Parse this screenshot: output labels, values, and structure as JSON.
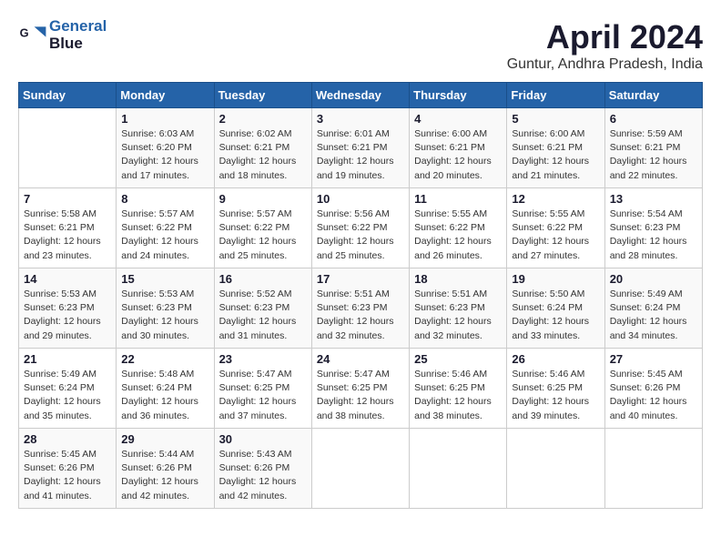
{
  "header": {
    "logo_line1": "General",
    "logo_line2": "Blue",
    "month_title": "April 2024",
    "location": "Guntur, Andhra Pradesh, India"
  },
  "columns": [
    "Sunday",
    "Monday",
    "Tuesday",
    "Wednesday",
    "Thursday",
    "Friday",
    "Saturday"
  ],
  "weeks": [
    [
      {
        "day": "",
        "info": ""
      },
      {
        "day": "1",
        "info": "Sunrise: 6:03 AM\nSunset: 6:20 PM\nDaylight: 12 hours\nand 17 minutes."
      },
      {
        "day": "2",
        "info": "Sunrise: 6:02 AM\nSunset: 6:21 PM\nDaylight: 12 hours\nand 18 minutes."
      },
      {
        "day": "3",
        "info": "Sunrise: 6:01 AM\nSunset: 6:21 PM\nDaylight: 12 hours\nand 19 minutes."
      },
      {
        "day": "4",
        "info": "Sunrise: 6:00 AM\nSunset: 6:21 PM\nDaylight: 12 hours\nand 20 minutes."
      },
      {
        "day": "5",
        "info": "Sunrise: 6:00 AM\nSunset: 6:21 PM\nDaylight: 12 hours\nand 21 minutes."
      },
      {
        "day": "6",
        "info": "Sunrise: 5:59 AM\nSunset: 6:21 PM\nDaylight: 12 hours\nand 22 minutes."
      }
    ],
    [
      {
        "day": "7",
        "info": "Sunrise: 5:58 AM\nSunset: 6:21 PM\nDaylight: 12 hours\nand 23 minutes."
      },
      {
        "day": "8",
        "info": "Sunrise: 5:57 AM\nSunset: 6:22 PM\nDaylight: 12 hours\nand 24 minutes."
      },
      {
        "day": "9",
        "info": "Sunrise: 5:57 AM\nSunset: 6:22 PM\nDaylight: 12 hours\nand 25 minutes."
      },
      {
        "day": "10",
        "info": "Sunrise: 5:56 AM\nSunset: 6:22 PM\nDaylight: 12 hours\nand 25 minutes."
      },
      {
        "day": "11",
        "info": "Sunrise: 5:55 AM\nSunset: 6:22 PM\nDaylight: 12 hours\nand 26 minutes."
      },
      {
        "day": "12",
        "info": "Sunrise: 5:55 AM\nSunset: 6:22 PM\nDaylight: 12 hours\nand 27 minutes."
      },
      {
        "day": "13",
        "info": "Sunrise: 5:54 AM\nSunset: 6:23 PM\nDaylight: 12 hours\nand 28 minutes."
      }
    ],
    [
      {
        "day": "14",
        "info": "Sunrise: 5:53 AM\nSunset: 6:23 PM\nDaylight: 12 hours\nand 29 minutes."
      },
      {
        "day": "15",
        "info": "Sunrise: 5:53 AM\nSunset: 6:23 PM\nDaylight: 12 hours\nand 30 minutes."
      },
      {
        "day": "16",
        "info": "Sunrise: 5:52 AM\nSunset: 6:23 PM\nDaylight: 12 hours\nand 31 minutes."
      },
      {
        "day": "17",
        "info": "Sunrise: 5:51 AM\nSunset: 6:23 PM\nDaylight: 12 hours\nand 32 minutes."
      },
      {
        "day": "18",
        "info": "Sunrise: 5:51 AM\nSunset: 6:23 PM\nDaylight: 12 hours\nand 32 minutes."
      },
      {
        "day": "19",
        "info": "Sunrise: 5:50 AM\nSunset: 6:24 PM\nDaylight: 12 hours\nand 33 minutes."
      },
      {
        "day": "20",
        "info": "Sunrise: 5:49 AM\nSunset: 6:24 PM\nDaylight: 12 hours\nand 34 minutes."
      }
    ],
    [
      {
        "day": "21",
        "info": "Sunrise: 5:49 AM\nSunset: 6:24 PM\nDaylight: 12 hours\nand 35 minutes."
      },
      {
        "day": "22",
        "info": "Sunrise: 5:48 AM\nSunset: 6:24 PM\nDaylight: 12 hours\nand 36 minutes."
      },
      {
        "day": "23",
        "info": "Sunrise: 5:47 AM\nSunset: 6:25 PM\nDaylight: 12 hours\nand 37 minutes."
      },
      {
        "day": "24",
        "info": "Sunrise: 5:47 AM\nSunset: 6:25 PM\nDaylight: 12 hours\nand 38 minutes."
      },
      {
        "day": "25",
        "info": "Sunrise: 5:46 AM\nSunset: 6:25 PM\nDaylight: 12 hours\nand 38 minutes."
      },
      {
        "day": "26",
        "info": "Sunrise: 5:46 AM\nSunset: 6:25 PM\nDaylight: 12 hours\nand 39 minutes."
      },
      {
        "day": "27",
        "info": "Sunrise: 5:45 AM\nSunset: 6:26 PM\nDaylight: 12 hours\nand 40 minutes."
      }
    ],
    [
      {
        "day": "28",
        "info": "Sunrise: 5:45 AM\nSunset: 6:26 PM\nDaylight: 12 hours\nand 41 minutes."
      },
      {
        "day": "29",
        "info": "Sunrise: 5:44 AM\nSunset: 6:26 PM\nDaylight: 12 hours\nand 42 minutes."
      },
      {
        "day": "30",
        "info": "Sunrise: 5:43 AM\nSunset: 6:26 PM\nDaylight: 12 hours\nand 42 minutes."
      },
      {
        "day": "",
        "info": ""
      },
      {
        "day": "",
        "info": ""
      },
      {
        "day": "",
        "info": ""
      },
      {
        "day": "",
        "info": ""
      }
    ]
  ]
}
